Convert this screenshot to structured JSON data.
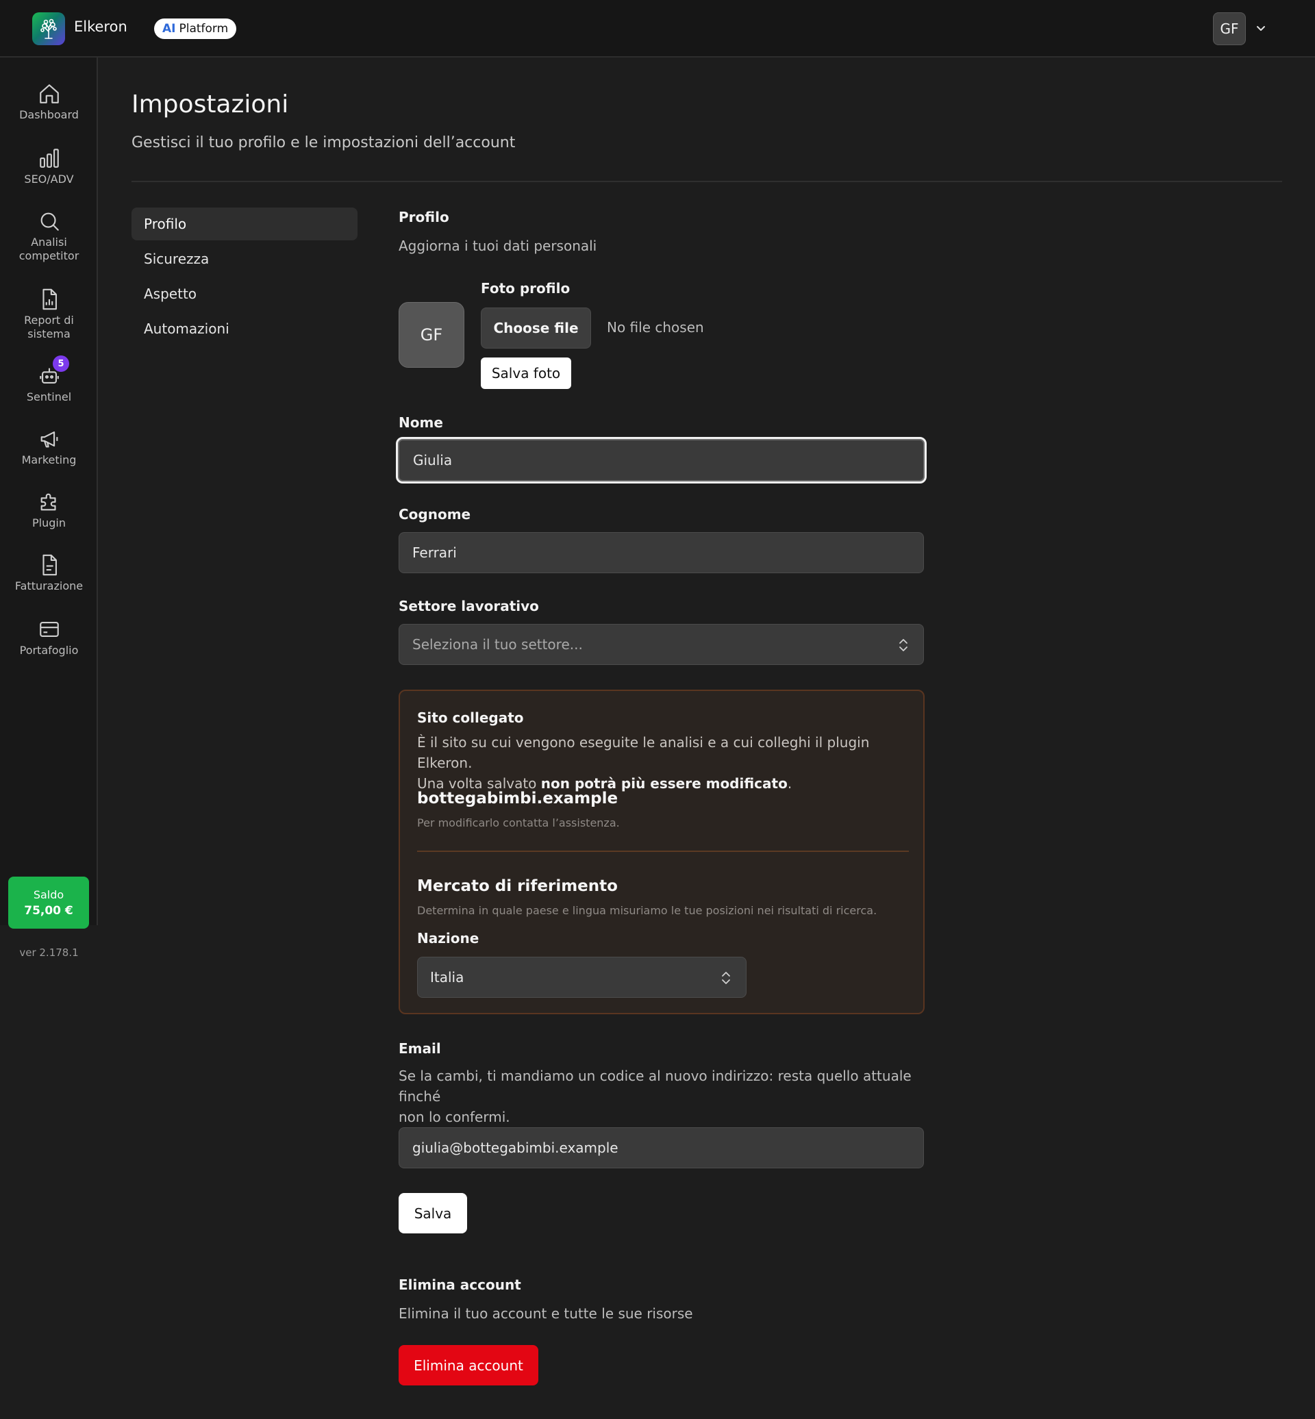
{
  "app": {
    "brand": "Elkeron",
    "badge_ai": "AI",
    "badge_label": "Platform",
    "user_initials": "GF"
  },
  "sidebar": {
    "items": [
      {
        "label": "Dashboard",
        "icon": "home-icon"
      },
      {
        "label": "SEO/ADV",
        "icon": "bar-chart-icon"
      },
      {
        "label": "Analisi competitor",
        "icon": "search-icon"
      },
      {
        "label": "Report di sistema",
        "icon": "document-chart-icon"
      },
      {
        "label": "Sentinel",
        "icon": "robot-icon",
        "badge": "5"
      },
      {
        "label": "Marketing",
        "icon": "megaphone-icon"
      },
      {
        "label": "Plugin",
        "icon": "puzzle-icon"
      },
      {
        "label": "Fatturazione",
        "icon": "invoice-icon"
      },
      {
        "label": "Portafoglio",
        "icon": "credit-card-icon"
      }
    ],
    "saldo_label": "Saldo",
    "saldo_value": "75,00 €",
    "version": "ver 2.178.1"
  },
  "header": {
    "title": "Impostazioni",
    "subtitle": "Gestisci il tuo profilo e le impostazioni dell’account"
  },
  "settings_nav": {
    "items": [
      "Profilo",
      "Sicurezza",
      "Aspetto",
      "Automazioni"
    ],
    "active": "Profilo"
  },
  "profile": {
    "section_title": "Profilo",
    "section_subtitle": "Aggiorna i tuoi dati personali",
    "photo_label": "Foto profilo",
    "avatar_initials": "GF",
    "choose_file": "Choose file",
    "no_file": "No file chosen",
    "save_photo": "Salva foto",
    "first_name_label": "Nome",
    "first_name_value": "Giulia",
    "last_name_label": "Cognome",
    "last_name_value": "Ferrari",
    "sector_label": "Settore lavorativo",
    "sector_placeholder": "Seleziona il tuo settore..."
  },
  "site_card": {
    "title": "Sito collegato",
    "desc_line1": "È il sito su cui vengono eseguite le analisi e a cui colleghi il plugin Elkeron.",
    "desc_line2_pre": "Una volta salvato ",
    "desc_line2_bold": "non potrà più essere modificato",
    "desc_line2_post": ".",
    "domain": "bottegabimbi.example",
    "contact_note": "Per modificarlo contatta l’assistenza.",
    "market_title": "Mercato di riferimento",
    "market_desc": "Determina in quale paese e lingua misuriamo le tue posizioni nei risultati di ricerca.",
    "country_label": "Nazione",
    "country_value": "Italia"
  },
  "email": {
    "label": "Email",
    "desc_line1": "Se la cambi, ti mandiamo un codice al nuovo indirizzo: resta quello attuale finché",
    "desc_line2": "non lo confermi.",
    "value": "giulia@bottegabimbi.example",
    "save": "Salva"
  },
  "delete_account": {
    "title": "Elimina account",
    "desc": "Elimina il tuo account e tutte le sue risorse",
    "button": "Elimina account"
  },
  "colors": {
    "background": "#1d1d1d",
    "saldo_green": "#1bb34b",
    "danger_red": "#e30613",
    "badge_purple": "#7c3aed",
    "card_border": "#5a3520"
  }
}
